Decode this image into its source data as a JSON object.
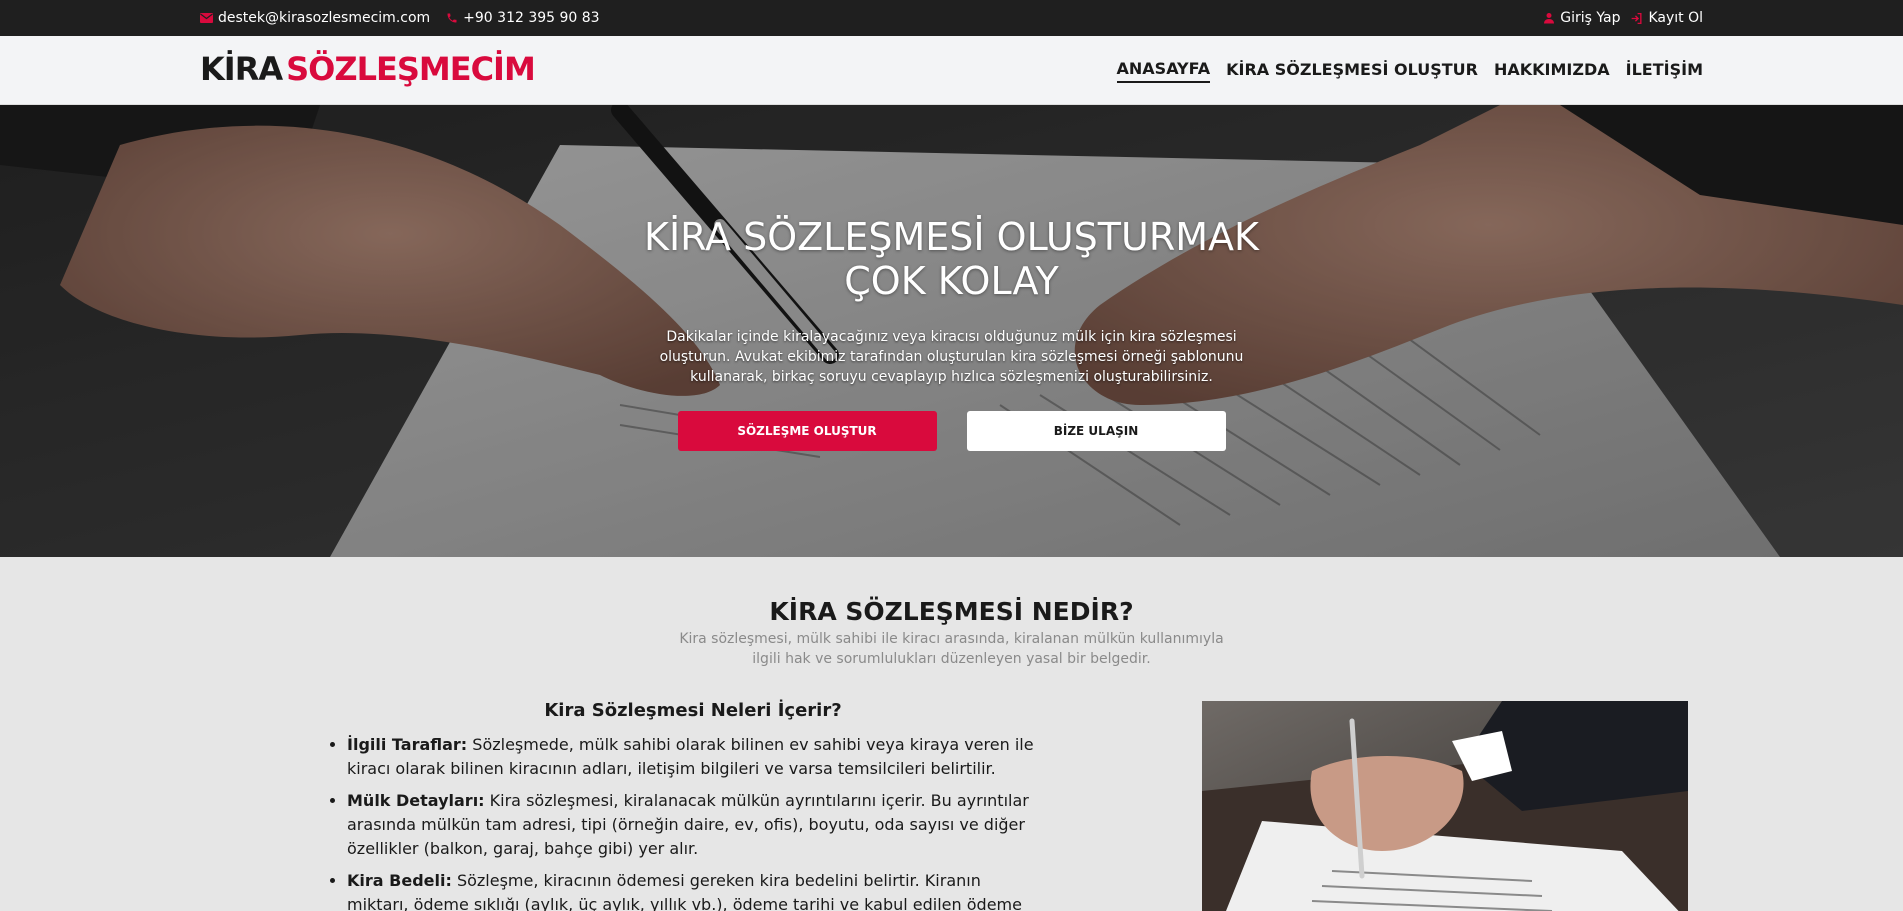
{
  "topbar": {
    "email": "destek@kirasozlesmecim.com",
    "phone": "+90 312 395 90 83",
    "login": "Giriş Yap",
    "register": "Kayıt Ol"
  },
  "header": {
    "logo_part1": "KİRA",
    "logo_part2": "SÖZLEŞMECİM",
    "nav": [
      "ANASAYFA",
      "KİRA SÖZLEŞMESİ OLUŞTUR",
      "HAKKIMIZDA",
      "İLETİŞİM"
    ]
  },
  "hero": {
    "title_line1": "KİRA SÖZLEŞMESİ OLUŞTURMAK",
    "title_line2": "ÇOK KOLAY",
    "description": "Dakikalar içinde kiralayacağınız veya kiracısı olduğunuz mülk için kira sözleşmesi oluşturun. Avukat ekibimiz tarafından oluşturulan kira sözleşmesi örneği şablonunu kullanarak, birkaç soruyu cevaplayıp hızlıca sözleşmenizi oluşturabilirsiniz.",
    "primary_button": "SÖZLEŞME OLUŞTUR",
    "secondary_button": "BİZE ULAŞIN"
  },
  "section": {
    "title": "KİRA SÖZLEŞMESİ NEDİR?",
    "subtitle": "Kira sözleşmesi, mülk sahibi ile kiracı arasında, kiralanan mülkün kullanımıyla ilgili hak ve sorumlulukları düzenleyen yasal bir belgedir.",
    "content_title": "Kira Sözleşmesi Neleri İçerir?",
    "items": [
      {
        "term": "İlgili Taraflar:",
        "text": " Sözleşmede, mülk sahibi olarak bilinen ev sahibi veya kiraya veren ile kiracı olarak bilinen kiracının adları, iletişim bilgileri ve varsa temsilcileri belirtilir."
      },
      {
        "term": "Mülk Detayları:",
        "text": " Kira sözleşmesi, kiralanacak mülkün ayrıntılarını içerir. Bu ayrıntılar arasında mülkün tam adresi, tipi (örneğin daire, ev, ofis), boyutu, oda sayısı ve diğer özellikler (balkon, garaj, bahçe gibi) yer alır."
      },
      {
        "term": "Kira Bedeli:",
        "text": " Sözleşme, kiracının ödemesi gereken kira bedelini belirtir. Kiranın miktarı, ödeme sıklığı (aylık, üç aylık, yıllık vb.), ödeme tarihi ve kabul edilen ödeme yöntemleri"
      }
    ]
  },
  "colors": {
    "accent": "#d90a3d",
    "topbar_bg": "#1f1f1f",
    "header_bg": "#f3f4f6",
    "section_bg": "#e6e6e6"
  }
}
